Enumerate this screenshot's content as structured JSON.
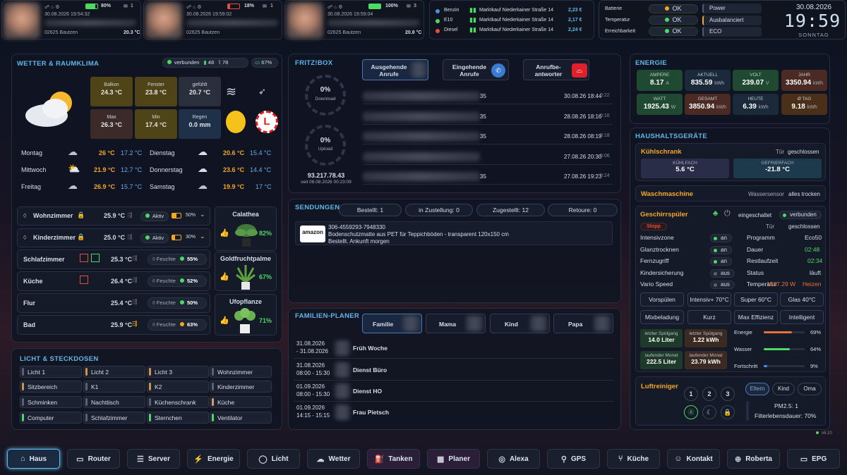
{
  "top": {
    "phones": [
      {
        "time": "30.08.2026 19:54:32",
        "battery": "80%",
        "mail": "1",
        "location": "02625 Bautzen",
        "temp": "20.3 °C"
      },
      {
        "time": "30.08.2026 19:59:02",
        "battery": "18%",
        "mail": "1",
        "location": "02625 Bautzen",
        "temp": ""
      },
      {
        "time": "30.08.2026 19:59:04",
        "battery": "100%",
        "mail": "3",
        "location": "02625 Bautzen",
        "temp": "20.8 °C"
      }
    ],
    "fuel": [
      {
        "type": "Benzin",
        "station": "Marktkauf Niederkainer Straße 14",
        "price": "2,23 €",
        "color": "#4a90e2"
      },
      {
        "type": "E10",
        "station": "Marktkauf Niederkainer Straße 14",
        "price": "2,17 €",
        "color": "#4cd964"
      },
      {
        "type": "Diesel",
        "station": "Marktkauf Niederkainer Straße 14",
        "price": "2,24 €",
        "color": "#e74c3c"
      }
    ],
    "status": [
      {
        "label": "Batterie",
        "value": "OK"
      },
      {
        "label": "Temperatur",
        "value": "OK"
      },
      {
        "label": "Erreichbarkeit",
        "value": "OK"
      }
    ],
    "modes": [
      "Power",
      "Ausbalanciert",
      "ECO"
    ],
    "date": "30.08.2026",
    "clock": "19:59",
    "weekday": "SONNTAG"
  },
  "weather": {
    "title": "WETTER & RAUMKLIMA",
    "connection": "verbunden",
    "signal1": "48",
    "signal2": "78",
    "battery": "67%",
    "cells": [
      {
        "label": "Balkon",
        "value": "24.3 °C"
      },
      {
        "label": "Fenster",
        "value": "23.8 °C"
      },
      {
        "label": "gefühlt",
        "value": "20.7 °C"
      },
      {
        "label": "Max",
        "value": "26.3 °C"
      },
      {
        "label": "Min",
        "value": "17.4 °C"
      },
      {
        "label": "Regen",
        "value": "0.0 mm"
      }
    ],
    "forecast": [
      {
        "day": "Montag",
        "max": "26 °C",
        "min": "17.2 °C"
      },
      {
        "day": "Dienstag",
        "max": "20.6 °C",
        "min": "15.4 °C"
      },
      {
        "day": "Mittwoch",
        "max": "21.9 °C",
        "min": "12.7 °C"
      },
      {
        "day": "Donnerstag",
        "max": "23.6 °C",
        "min": "14.4 °C"
      },
      {
        "day": "Freitag",
        "max": "26.9 °C",
        "min": "15.7 °C"
      },
      {
        "day": "Samstag",
        "max": "19.9 °C",
        "min": "17 °C"
      }
    ]
  },
  "rooms": [
    {
      "name": "Wohnzimmer",
      "temp": "25.9 °C",
      "state": "Aktiv",
      "pct": "50%"
    },
    {
      "name": "Kinderzimmer",
      "temp": "25.0 °C",
      "state": "Aktiv",
      "pct": "30%"
    },
    {
      "name": "Schlafzimmer",
      "temp": "25.3 °C",
      "state": "Feuchte",
      "pct": "55%"
    },
    {
      "name": "Küche",
      "temp": "26.4 °C",
      "state": "Feuchte",
      "pct": "52%"
    },
    {
      "name": "Flur",
      "temp": "25.4 °C",
      "state": "Feuchte",
      "pct": "50%"
    },
    {
      "name": "Bad",
      "temp": "25.9 °C",
      "state": "Feuchte",
      "pct": "63%"
    }
  ],
  "plants": [
    {
      "name": "Calathea",
      "pct": "82%"
    },
    {
      "name": "Goldfruchtpalme",
      "pct": "67%"
    },
    {
      "name": "Ufopflanze",
      "pct": "71%"
    }
  ],
  "lights": {
    "title": "LICHT & STECKDOSEN",
    "items": [
      {
        "label": "Licht 1",
        "color": "#5a6272"
      },
      {
        "label": "Licht 2",
        "color": "#c9974a"
      },
      {
        "label": "Licht 3",
        "color": "#c9974a"
      },
      {
        "label": "Wohnzimmer",
        "color": "#5a6272"
      },
      {
        "label": "Sitzbereich",
        "color": "#c9974a"
      },
      {
        "label": "K1",
        "color": "#5a6272"
      },
      {
        "label": "K2",
        "color": "#c9974a"
      },
      {
        "label": "Kinderzimmer",
        "color": "#5a6272"
      },
      {
        "label": "Schminken",
        "color": "#5a6272"
      },
      {
        "label": "Nachttisch",
        "color": "#5a6272"
      },
      {
        "label": "Küchenschrank",
        "color": "#5a6272"
      },
      {
        "label": "Küche",
        "color": "#d19a7a"
      },
      {
        "label": "Computer",
        "color": "#4cd964"
      },
      {
        "label": "Schlafzimmer",
        "color": "#5a6272"
      },
      {
        "label": "Sternchen",
        "color": "#4cd964"
      },
      {
        "label": "Ventilator",
        "color": "#4cd964"
      }
    ]
  },
  "fritz": {
    "title": "FRITZ!BOX",
    "download": "0%",
    "download_label": "Download",
    "upload": "0%",
    "upload_label": "Upload",
    "ip": "93.217.78.43",
    "since": "seit 08.08.2026 00:23:09",
    "tabs": [
      "Ausgehende Anrufe",
      "Eingehende Anrufe",
      "Anrufbe-antworter"
    ],
    "calls": [
      {
        "num": "35",
        "date": "30.08.26 18:44",
        "dur": "0:22"
      },
      {
        "num": "35",
        "date": "28.08.26 18:16",
        "dur": "0:16"
      },
      {
        "num": "35",
        "date": "28.08.26 08:19",
        "dur": "0:18"
      },
      {
        "num": "",
        "date": "27.08.26 20:30",
        "dur": "0:06"
      },
      {
        "num": "35",
        "date": "27.08.26 19:23",
        "dur": "0:24"
      }
    ]
  },
  "deliveries": {
    "title": "SENDUNGEN",
    "tabs": [
      "Bestellt: 1",
      "in Zustellung: 0",
      "Zugestellt: 12",
      "Retoure: 0"
    ],
    "order_id": "306-4559293-7948330",
    "order_desc": "Bodenschutzmatte aus PET für Teppichböden - transparent 120x150 cm",
    "order_status": "Bestellt. Ankunft morgen"
  },
  "family": {
    "title": "FAMILIEN-PLANER",
    "tabs": [
      "Familie",
      "Mama",
      "Kind",
      "Papa"
    ],
    "entries": [
      {
        "when1": "31.08.2026",
        "when2": "- 31.08.2026",
        "what": "Früh Woche"
      },
      {
        "when1": "31.08.2026",
        "when2": "08:00 - 15:30",
        "what": "Dienst Büro"
      },
      {
        "when1": "01.09.2026",
        "when2": "08:00 - 15:30",
        "what": "Dienst HO"
      },
      {
        "when1": "01.09.2026",
        "when2": "14:15 - 15:15",
        "what": "Frau Pietsch"
      }
    ]
  },
  "energy": {
    "title": "ENERGIE",
    "cells": [
      {
        "label": "AMPERE",
        "value": "8.17",
        "unit": "A",
        "bg": "#1f4a31"
      },
      {
        "label": "AKTUELL",
        "value": "835.59",
        "unit": "kWh",
        "bg": "#1b2a3a"
      },
      {
        "label": "VOLT",
        "value": "239.07",
        "unit": "V",
        "bg": "#1f4a31"
      },
      {
        "label": "JAHR",
        "value": "3350.94",
        "unit": "kWh",
        "bg": "#4a2a22"
      },
      {
        "label": "WATT",
        "value": "1925.43",
        "unit": "W",
        "bg": "#1f4a31"
      },
      {
        "label": "GESAMT",
        "value": "3850.94",
        "unit": "kWh",
        "bg": "#4a2a22"
      },
      {
        "label": "HEUTE",
        "value": "6.39",
        "unit": "kWh",
        "bg": "#1b2a3a"
      },
      {
        "label": "Ø TAG",
        "value": "9.18",
        "unit": "kWh",
        "bg": "#4a3018"
      }
    ]
  },
  "appliances": {
    "title": "HAUSHALTSGERÄTE",
    "fridge": {
      "name": "Kühlschrank",
      "door_label": "Tür",
      "door": "geschlossen",
      "cool_label": "KÜHLFACH",
      "cool": "5.6 °C",
      "freeze_label": "GEFRIERFACH",
      "freeze": "-21.8 °C"
    },
    "washer": {
      "name": "Waschmaschine",
      "sensor_label": "Wassersensor",
      "sensor": "alles trocken"
    },
    "dishwasher": {
      "name": "Geschirrspüler",
      "power": "eingeschaltet",
      "conn": "verbunden",
      "stop": "Stopp",
      "door_label": "Tür",
      "door": "geschlossen",
      "left": [
        {
          "label": "Intensivzone",
          "value": "an"
        },
        {
          "label": "Glanztrocknen",
          "value": "an"
        },
        {
          "label": "Fernzugriff",
          "value": "an"
        },
        {
          "label": "Kindersicherung",
          "value": "aus"
        },
        {
          "label": "Vario Speed",
          "value": "aus"
        }
      ],
      "right": [
        {
          "label": "Programm",
          "value": "Eco50"
        },
        {
          "label": "Dauer",
          "value": "02:48"
        },
        {
          "label": "Restlaufzeit",
          "value": "02:34"
        },
        {
          "label": "Status",
          "value": "läuft"
        },
        {
          "label": "Temperatur",
          "value": "1587.29 W"
        },
        {
          "label": "",
          "value": "Heizen"
        }
      ],
      "programs": [
        "Vorspülen",
        "Intensiv+ 70°C",
        "Super 60°C",
        "Glas 40°C",
        "Mixbeladung",
        "Kurz",
        "Max Effizienz",
        "Intelligent"
      ],
      "stats": [
        {
          "label": "letzter Spülgang",
          "value": "14.0 Liter"
        },
        {
          "label": "letzter Spülgang",
          "value": "1.22 kWh"
        },
        {
          "label": "laufender Monat",
          "value": "222.5 Liter"
        },
        {
          "label": "laufender Monat",
          "value": "23.79 kWh"
        }
      ],
      "bars": [
        {
          "label": "Energie",
          "pct": "69%",
          "value": 0.69,
          "color": "#e8703a"
        },
        {
          "label": "Wasser",
          "pct": "64%",
          "value": 0.64,
          "color": "#4cd964"
        },
        {
          "label": "Fortschritt",
          "pct": "9%",
          "value": 0.09,
          "color": "#4a90e2"
        }
      ]
    },
    "purifier": {
      "name": "Luftreiniger",
      "speeds": [
        "1",
        "2",
        "3"
      ],
      "modes": [
        "Eltern",
        "Kind",
        "Oma"
      ],
      "pm": "PM2.5: 1",
      "filter": "Filterlebensdauer: 70%"
    },
    "version": "v6.10"
  },
  "nav": [
    "Haus",
    "Router",
    "Server",
    "Energie",
    "Licht",
    "Wetter",
    "Tanken",
    "Planer",
    "Alexa",
    "GPS",
    "Küche",
    "Kontakt",
    "Roberta",
    "EPG"
  ]
}
